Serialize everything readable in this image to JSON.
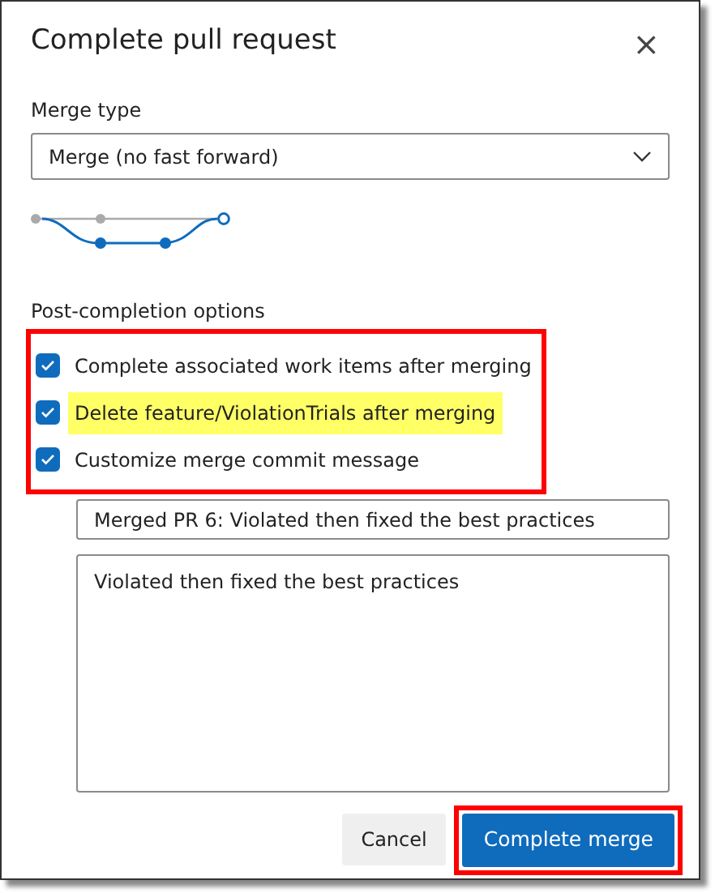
{
  "dialog": {
    "title": "Complete pull request",
    "close_icon": "×"
  },
  "merge_type": {
    "label": "Merge type",
    "value": "Merge (no fast forward)"
  },
  "post_completion": {
    "label": "Post-completion options",
    "outlined": true,
    "options": [
      {
        "label": "Complete associated work items after merging",
        "checked": true,
        "highlighted": false
      },
      {
        "label": "Delete feature/ViolationTrials after merging",
        "checked": true,
        "highlighted": true
      },
      {
        "label": "Customize merge commit message",
        "checked": true,
        "highlighted": false
      }
    ]
  },
  "commit_title": {
    "value": "Merged PR 6: Violated then fixed the best practices"
  },
  "commit_message": {
    "value": "Violated then fixed the best practices"
  },
  "buttons": [
    {
      "label": "Cancel",
      "kind": "secondary",
      "outlined": false
    },
    {
      "label": "Complete merge",
      "kind": "primary",
      "outlined": true
    }
  ]
}
